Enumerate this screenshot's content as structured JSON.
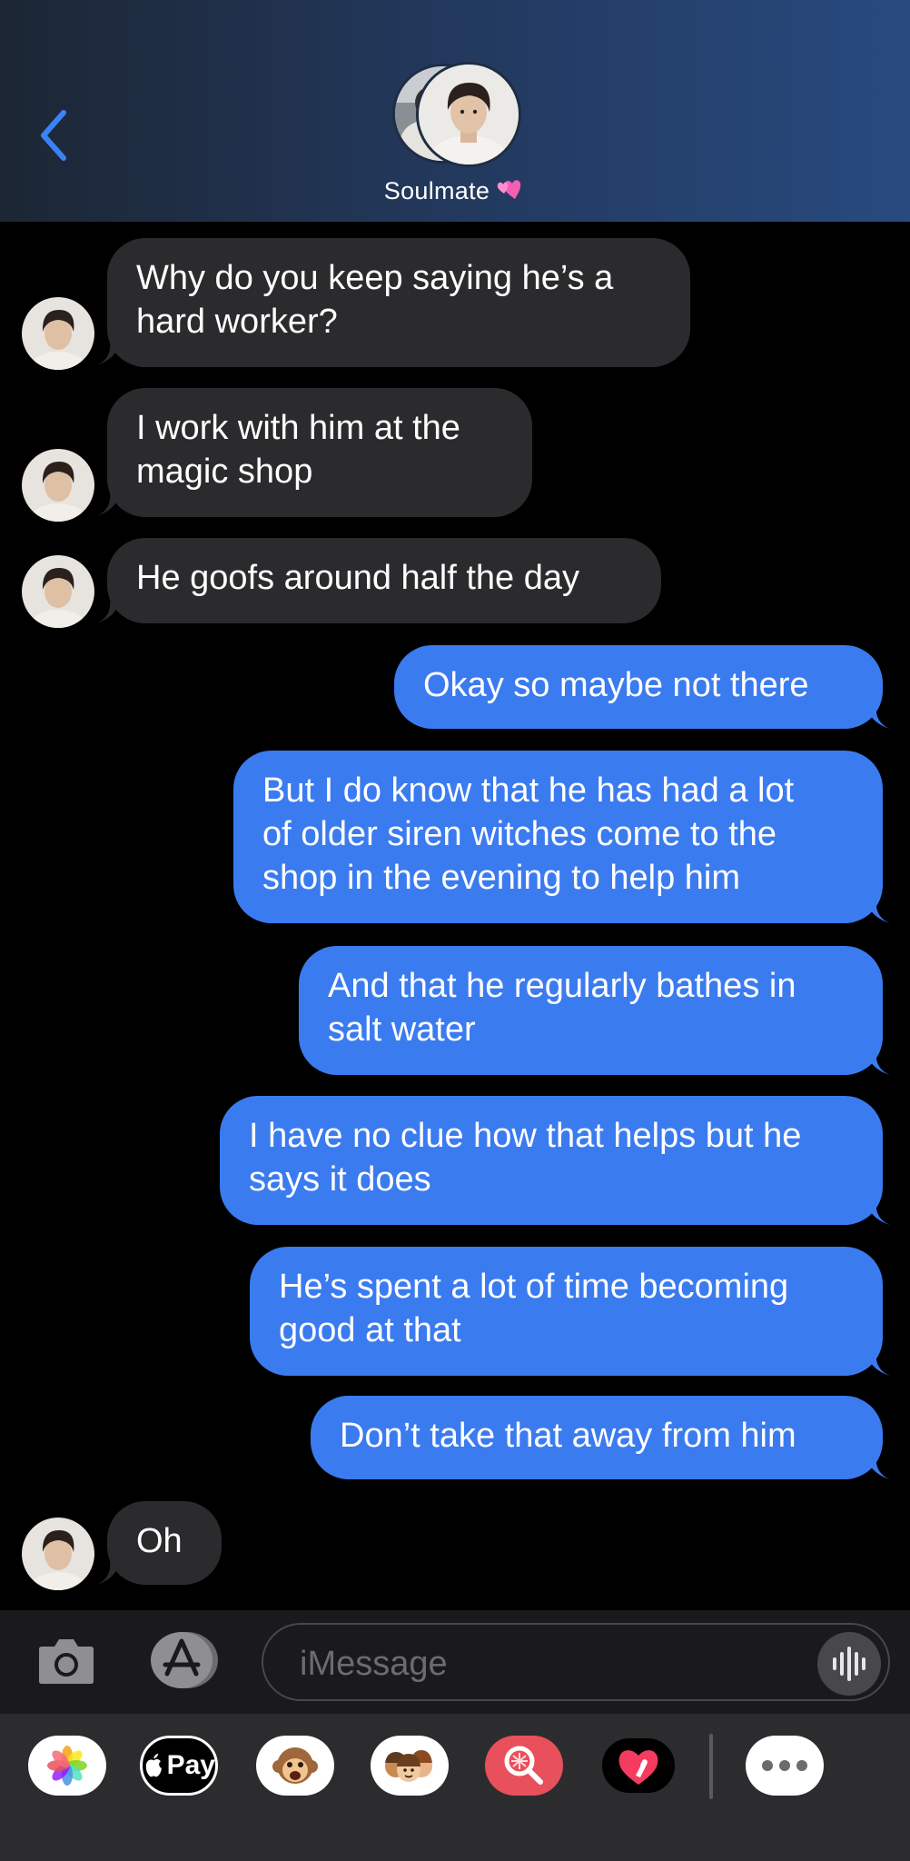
{
  "header": {
    "contact_name": "Soulmate",
    "heart_emoji": "💕",
    "accent_color": "#3b82f6"
  },
  "messages": [
    {
      "side": "in",
      "text": "Why do you keep saying he’s a\nhard worker?"
    },
    {
      "side": "in",
      "text": "I work with him at the\nmagic shop"
    },
    {
      "side": "in",
      "text": "He goofs around half the day"
    },
    {
      "side": "out",
      "text": "Okay so maybe not there"
    },
    {
      "side": "out",
      "text": "But I do know that he has had a lot\nof older siren witches come to the\nshop in the evening to help him"
    },
    {
      "side": "out",
      "text": "And that he regularly bathes in\nsalt water"
    },
    {
      "side": "out",
      "text": "I have no clue how that helps but he\nsays it does"
    },
    {
      "side": "out",
      "text": "He’s spent a lot of time becoming\ngood at that"
    },
    {
      "side": "out",
      "text": "Don’t take that away from him"
    },
    {
      "side": "in",
      "text": "Oh"
    }
  ],
  "composer": {
    "placeholder": "iMessage",
    "icons": [
      "camera-icon",
      "app-store-icon",
      "voice-waveform-icon"
    ]
  },
  "app_drawer": {
    "apple_pay_label": "Pay",
    "apps": [
      "photos",
      "apple-pay",
      "animoji-monkey",
      "memoji-stickers",
      "images-search",
      "digital-touch",
      "more"
    ],
    "colors": {
      "bubble_in": "#2b2b2d",
      "bubble_out": "#3b7bf0",
      "images_search": "#e8505b"
    }
  }
}
